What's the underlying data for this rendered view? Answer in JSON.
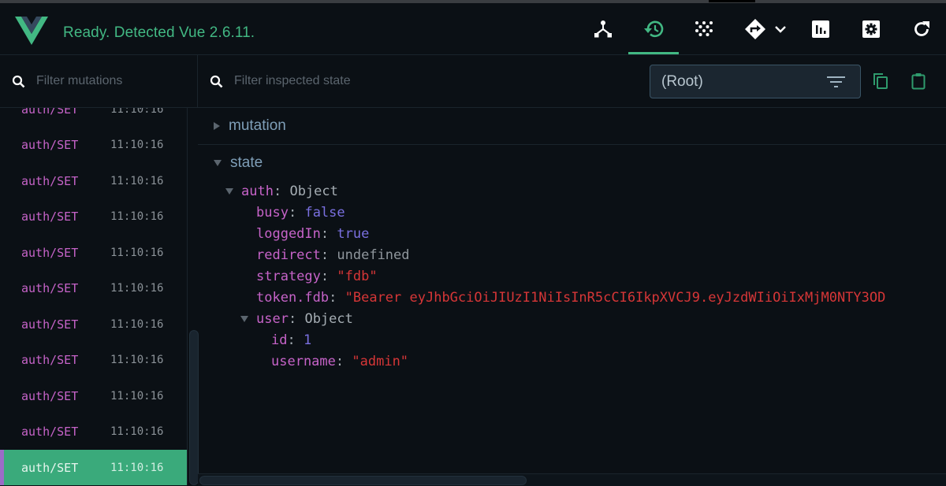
{
  "header": {
    "logo": "vue-logo",
    "status_text": "Ready. Detected Vue 2.6.11.",
    "nav": [
      {
        "name": "components",
        "icon": "component-tree-icon",
        "active": false
      },
      {
        "name": "vuex",
        "icon": "history-icon",
        "active": true
      },
      {
        "name": "events",
        "icon": "events-dots-icon",
        "active": false
      },
      {
        "name": "routing",
        "icon": "route-sign-icon",
        "active": false,
        "has_dropdown": true
      },
      {
        "name": "performance",
        "icon": "bar-chart-icon",
        "active": false
      },
      {
        "name": "settings",
        "icon": "settings-gear-icon",
        "active": false
      },
      {
        "name": "refresh",
        "icon": "refresh-icon",
        "active": false
      }
    ]
  },
  "colors": {
    "accent": "#42b883",
    "selected_row": "#3aaa7b",
    "selected_marker": "#9b6cc7",
    "key": "#c663c8",
    "string": "#d63637",
    "literal": "#7a70e0"
  },
  "mutations": {
    "filter_placeholder": "Filter mutations",
    "filter_value": "",
    "items": [
      {
        "name": "auth/SET",
        "time": "11:10:16",
        "selected": false
      },
      {
        "name": "auth/SET",
        "time": "11:10:16",
        "selected": false
      },
      {
        "name": "auth/SET",
        "time": "11:10:16",
        "selected": false
      },
      {
        "name": "auth/SET",
        "time": "11:10:16",
        "selected": false
      },
      {
        "name": "auth/SET",
        "time": "11:10:16",
        "selected": false
      },
      {
        "name": "auth/SET",
        "time": "11:10:16",
        "selected": false
      },
      {
        "name": "auth/SET",
        "time": "11:10:16",
        "selected": false
      },
      {
        "name": "auth/SET",
        "time": "11:10:16",
        "selected": false
      },
      {
        "name": "auth/SET",
        "time": "11:10:16",
        "selected": false
      },
      {
        "name": "auth/SET",
        "time": "11:10:16",
        "selected": false
      },
      {
        "name": "auth/SET",
        "time": "11:10:16",
        "selected": true
      }
    ]
  },
  "inspector": {
    "filter_placeholder": "Filter inspected state",
    "filter_value": "",
    "module_select": "(Root)",
    "copy_icon": "copy-icon",
    "paste_icon": "clipboard-icon",
    "sections": [
      {
        "label": "mutation",
        "expanded": false
      },
      {
        "label": "state",
        "expanded": true
      }
    ],
    "state": {
      "auth": {
        "key": "auth",
        "type": "Object"
      },
      "busy": {
        "key": "busy",
        "value": "false"
      },
      "loggedIn": {
        "key": "loggedIn",
        "value": "true"
      },
      "redirect": {
        "key": "redirect",
        "value": "undefined"
      },
      "strategy": {
        "key": "strategy",
        "value": "\"fdb\""
      },
      "token": {
        "key": "token.fdb",
        "value": "\"Bearer eyJhbGciOiJIUzI1NiIsInR5cCI6IkpXVCJ9.eyJzdWIiOiIxMjM0NTY3OD"
      },
      "user": {
        "key": "user",
        "type": "Object"
      },
      "id": {
        "key": "id",
        "value": "1"
      },
      "username": {
        "key": "username",
        "value": "\"admin\""
      }
    },
    "colon": ":"
  }
}
